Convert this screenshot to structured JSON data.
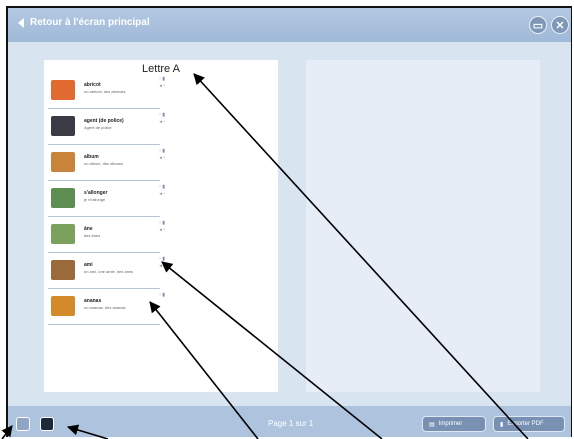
{
  "topbar": {
    "back_label": "Retour à l'écran principal",
    "icons": [
      "window-icon",
      "close-icon"
    ]
  },
  "dictionary_page": {
    "title": "Lettre A",
    "entries": [
      {
        "word": "abricot",
        "sub": "un abricot, des abricots",
        "thumb_color": "#e06a2f"
      },
      {
        "word": "agent (de police)",
        "sub": "Agent de police",
        "thumb_color": "#3b3b45"
      },
      {
        "word": "album",
        "sub": "un album, des albums",
        "thumb_color": "#c9843c"
      },
      {
        "word": "s'allonger",
        "sub": "je m'allonge",
        "thumb_color": "#5f8e52"
      },
      {
        "word": "âne",
        "sub": "des ânes",
        "thumb_color": "#7ca15c"
      },
      {
        "word": "ami",
        "sub": "un ami, une amie, des amis",
        "thumb_color": "#9a6a3a"
      },
      {
        "word": "ananas",
        "sub": "un ananas, des ananas",
        "thumb_color": "#d48a2a"
      }
    ]
  },
  "bottombar": {
    "page_info": "Page 1 sur 1",
    "print_label": "Imprimer",
    "export_label": "Exporter PDF"
  }
}
